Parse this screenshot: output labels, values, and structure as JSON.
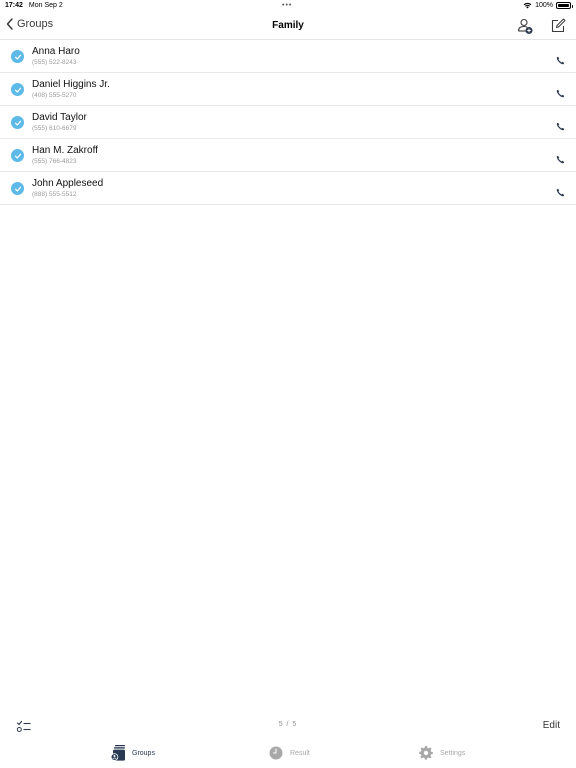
{
  "status_bar": {
    "time": "17:42",
    "date": "Mon Sep 2",
    "dots": "•••",
    "battery": "100%"
  },
  "nav": {
    "back_label": "Groups",
    "title": "Family",
    "add_contact_icon": "person-add-icon",
    "compose_icon": "compose-icon"
  },
  "contacts": [
    {
      "name": "Anna Haro",
      "phone": "(555) 522-8243",
      "checked": true
    },
    {
      "name": "Daniel Higgins Jr.",
      "phone": "(408) 555-5270",
      "checked": true
    },
    {
      "name": "David Taylor",
      "phone": "(555) 610-6679",
      "checked": true
    },
    {
      "name": "Han M. Zakroff",
      "phone": "(555) 766-4823",
      "checked": true
    },
    {
      "name": "John Appleseed",
      "phone": "(888) 555-5512",
      "checked": true
    }
  ],
  "toolbar": {
    "select_icon": "checklist-icon",
    "page_indicator": "5 / 5",
    "edit_label": "Edit"
  },
  "tabs": [
    {
      "label": "Groups",
      "icon": "groups-icon",
      "active": true
    },
    {
      "label": "Result",
      "icon": "clock-icon",
      "active": false
    },
    {
      "label": "Settings",
      "icon": "gear-icon",
      "active": false
    }
  ],
  "colors": {
    "check": "#5db9e8",
    "active_tab": "#2a3a55",
    "inactive_tab": "#a8a8a8"
  }
}
